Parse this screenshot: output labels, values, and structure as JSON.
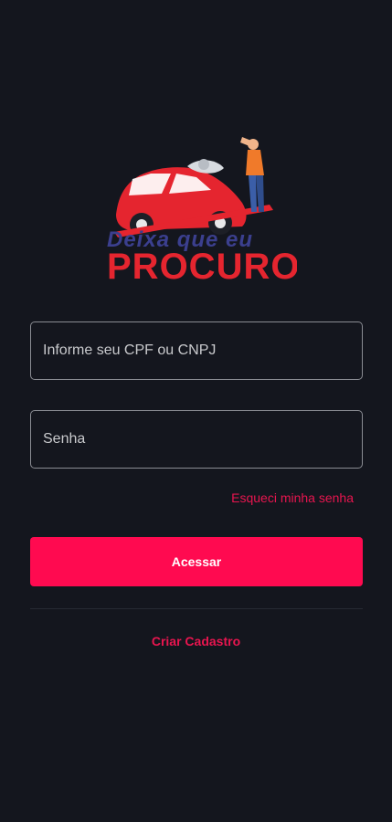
{
  "logo": {
    "line1": "Deixa que eu",
    "line2": "PROCURO",
    "colors": {
      "car": "#e5252f",
      "line1": "#3b3f8e",
      "line2": "#e5252f"
    }
  },
  "login": {
    "cpf_placeholder": "Informe seu CPF ou CNPJ",
    "password_placeholder": "Senha",
    "forgot_label": "Esqueci minha senha",
    "submit_label": "Acessar",
    "register_label": "Criar Cadastro"
  },
  "colors": {
    "background": "#14161e",
    "accent": "#ff0a50",
    "field_border": "#8a8c93"
  }
}
